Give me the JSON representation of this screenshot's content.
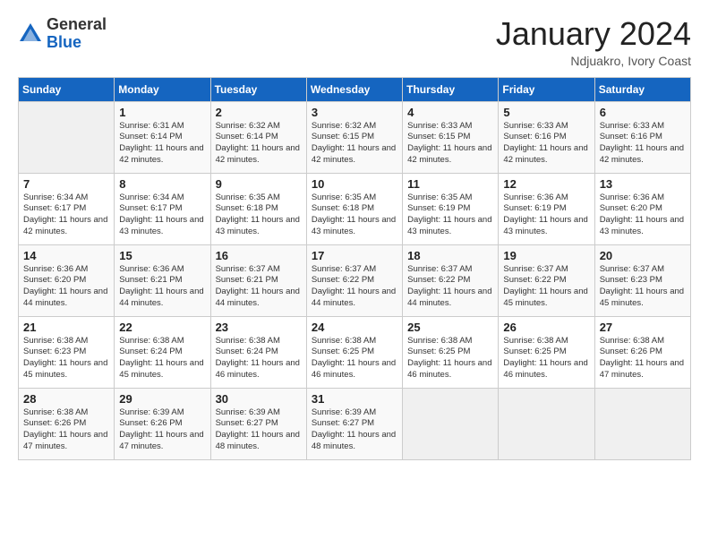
{
  "logo": {
    "general": "General",
    "blue": "Blue"
  },
  "header": {
    "month": "January 2024",
    "location": "Ndjuakro, Ivory Coast"
  },
  "weekdays": [
    "Sunday",
    "Monday",
    "Tuesday",
    "Wednesday",
    "Thursday",
    "Friday",
    "Saturday"
  ],
  "weeks": [
    [
      {
        "day": "",
        "sunrise": "",
        "sunset": "",
        "daylight": ""
      },
      {
        "day": "1",
        "sunrise": "Sunrise: 6:31 AM",
        "sunset": "Sunset: 6:14 PM",
        "daylight": "Daylight: 11 hours and 42 minutes."
      },
      {
        "day": "2",
        "sunrise": "Sunrise: 6:32 AM",
        "sunset": "Sunset: 6:14 PM",
        "daylight": "Daylight: 11 hours and 42 minutes."
      },
      {
        "day": "3",
        "sunrise": "Sunrise: 6:32 AM",
        "sunset": "Sunset: 6:15 PM",
        "daylight": "Daylight: 11 hours and 42 minutes."
      },
      {
        "day": "4",
        "sunrise": "Sunrise: 6:33 AM",
        "sunset": "Sunset: 6:15 PM",
        "daylight": "Daylight: 11 hours and 42 minutes."
      },
      {
        "day": "5",
        "sunrise": "Sunrise: 6:33 AM",
        "sunset": "Sunset: 6:16 PM",
        "daylight": "Daylight: 11 hours and 42 minutes."
      },
      {
        "day": "6",
        "sunrise": "Sunrise: 6:33 AM",
        "sunset": "Sunset: 6:16 PM",
        "daylight": "Daylight: 11 hours and 42 minutes."
      }
    ],
    [
      {
        "day": "7",
        "sunrise": "Sunrise: 6:34 AM",
        "sunset": "Sunset: 6:17 PM",
        "daylight": "Daylight: 11 hours and 42 minutes."
      },
      {
        "day": "8",
        "sunrise": "Sunrise: 6:34 AM",
        "sunset": "Sunset: 6:17 PM",
        "daylight": "Daylight: 11 hours and 43 minutes."
      },
      {
        "day": "9",
        "sunrise": "Sunrise: 6:35 AM",
        "sunset": "Sunset: 6:18 PM",
        "daylight": "Daylight: 11 hours and 43 minutes."
      },
      {
        "day": "10",
        "sunrise": "Sunrise: 6:35 AM",
        "sunset": "Sunset: 6:18 PM",
        "daylight": "Daylight: 11 hours and 43 minutes."
      },
      {
        "day": "11",
        "sunrise": "Sunrise: 6:35 AM",
        "sunset": "Sunset: 6:19 PM",
        "daylight": "Daylight: 11 hours and 43 minutes."
      },
      {
        "day": "12",
        "sunrise": "Sunrise: 6:36 AM",
        "sunset": "Sunset: 6:19 PM",
        "daylight": "Daylight: 11 hours and 43 minutes."
      },
      {
        "day": "13",
        "sunrise": "Sunrise: 6:36 AM",
        "sunset": "Sunset: 6:20 PM",
        "daylight": "Daylight: 11 hours and 43 minutes."
      }
    ],
    [
      {
        "day": "14",
        "sunrise": "Sunrise: 6:36 AM",
        "sunset": "Sunset: 6:20 PM",
        "daylight": "Daylight: 11 hours and 44 minutes."
      },
      {
        "day": "15",
        "sunrise": "Sunrise: 6:36 AM",
        "sunset": "Sunset: 6:21 PM",
        "daylight": "Daylight: 11 hours and 44 minutes."
      },
      {
        "day": "16",
        "sunrise": "Sunrise: 6:37 AM",
        "sunset": "Sunset: 6:21 PM",
        "daylight": "Daylight: 11 hours and 44 minutes."
      },
      {
        "day": "17",
        "sunrise": "Sunrise: 6:37 AM",
        "sunset": "Sunset: 6:22 PM",
        "daylight": "Daylight: 11 hours and 44 minutes."
      },
      {
        "day": "18",
        "sunrise": "Sunrise: 6:37 AM",
        "sunset": "Sunset: 6:22 PM",
        "daylight": "Daylight: 11 hours and 44 minutes."
      },
      {
        "day": "19",
        "sunrise": "Sunrise: 6:37 AM",
        "sunset": "Sunset: 6:22 PM",
        "daylight": "Daylight: 11 hours and 45 minutes."
      },
      {
        "day": "20",
        "sunrise": "Sunrise: 6:37 AM",
        "sunset": "Sunset: 6:23 PM",
        "daylight": "Daylight: 11 hours and 45 minutes."
      }
    ],
    [
      {
        "day": "21",
        "sunrise": "Sunrise: 6:38 AM",
        "sunset": "Sunset: 6:23 PM",
        "daylight": "Daylight: 11 hours and 45 minutes."
      },
      {
        "day": "22",
        "sunrise": "Sunrise: 6:38 AM",
        "sunset": "Sunset: 6:24 PM",
        "daylight": "Daylight: 11 hours and 45 minutes."
      },
      {
        "day": "23",
        "sunrise": "Sunrise: 6:38 AM",
        "sunset": "Sunset: 6:24 PM",
        "daylight": "Daylight: 11 hours and 46 minutes."
      },
      {
        "day": "24",
        "sunrise": "Sunrise: 6:38 AM",
        "sunset": "Sunset: 6:25 PM",
        "daylight": "Daylight: 11 hours and 46 minutes."
      },
      {
        "day": "25",
        "sunrise": "Sunrise: 6:38 AM",
        "sunset": "Sunset: 6:25 PM",
        "daylight": "Daylight: 11 hours and 46 minutes."
      },
      {
        "day": "26",
        "sunrise": "Sunrise: 6:38 AM",
        "sunset": "Sunset: 6:25 PM",
        "daylight": "Daylight: 11 hours and 46 minutes."
      },
      {
        "day": "27",
        "sunrise": "Sunrise: 6:38 AM",
        "sunset": "Sunset: 6:26 PM",
        "daylight": "Daylight: 11 hours and 47 minutes."
      }
    ],
    [
      {
        "day": "28",
        "sunrise": "Sunrise: 6:38 AM",
        "sunset": "Sunset: 6:26 PM",
        "daylight": "Daylight: 11 hours and 47 minutes."
      },
      {
        "day": "29",
        "sunrise": "Sunrise: 6:39 AM",
        "sunset": "Sunset: 6:26 PM",
        "daylight": "Daylight: 11 hours and 47 minutes."
      },
      {
        "day": "30",
        "sunrise": "Sunrise: 6:39 AM",
        "sunset": "Sunset: 6:27 PM",
        "daylight": "Daylight: 11 hours and 48 minutes."
      },
      {
        "day": "31",
        "sunrise": "Sunrise: 6:39 AM",
        "sunset": "Sunset: 6:27 PM",
        "daylight": "Daylight: 11 hours and 48 minutes."
      },
      {
        "day": "",
        "sunrise": "",
        "sunset": "",
        "daylight": ""
      },
      {
        "day": "",
        "sunrise": "",
        "sunset": "",
        "daylight": ""
      },
      {
        "day": "",
        "sunrise": "",
        "sunset": "",
        "daylight": ""
      }
    ]
  ]
}
